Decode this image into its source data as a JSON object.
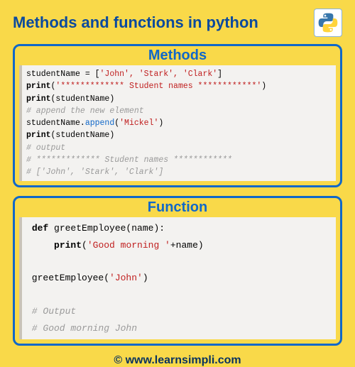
{
  "header": {
    "title": "Methods and functions in python",
    "logo_alt": "python-logo"
  },
  "methods": {
    "heading": "Methods",
    "code": {
      "line1_a": "studentName = [",
      "line1_str": "'John', 'Stark', 'Clark'",
      "line1_b": "]",
      "line2_kw": "print",
      "line2_paren_open": "(",
      "line2_str": "'************* Student names ************'",
      "line2_paren_close": ")",
      "line3_kw": "print",
      "line3_rest": "(studentName)",
      "line4_comment": "# append the new element",
      "line5_a": "studentName.",
      "line5_method": "append",
      "line5_popen": "(",
      "line5_str": "'Mickel'",
      "line5_pclose": ")",
      "line6_kw": "print",
      "line6_rest": "(studentName)",
      "line7_comment": "# output",
      "line8_comment": "# ************* Student names ************",
      "line9_comment": "# ['John', 'Stark', 'Clark']"
    }
  },
  "function": {
    "heading": "Function",
    "code": {
      "line1_def": "def",
      "line1_rest": " greetEmployee(name):",
      "line2_indent": "     ",
      "line2_kw": "print",
      "line2_popen": "(",
      "line2_str": "'Good morning '",
      "line2_rest": "+name)",
      "blank": "",
      "line3_a": " greetEmployee(",
      "line3_str": "'John'",
      "line3_b": ")",
      "line4_comment": " # Output",
      "line5_comment": " # Good morning John"
    }
  },
  "footer": {
    "text": "© www.learnsimpli.com"
  }
}
